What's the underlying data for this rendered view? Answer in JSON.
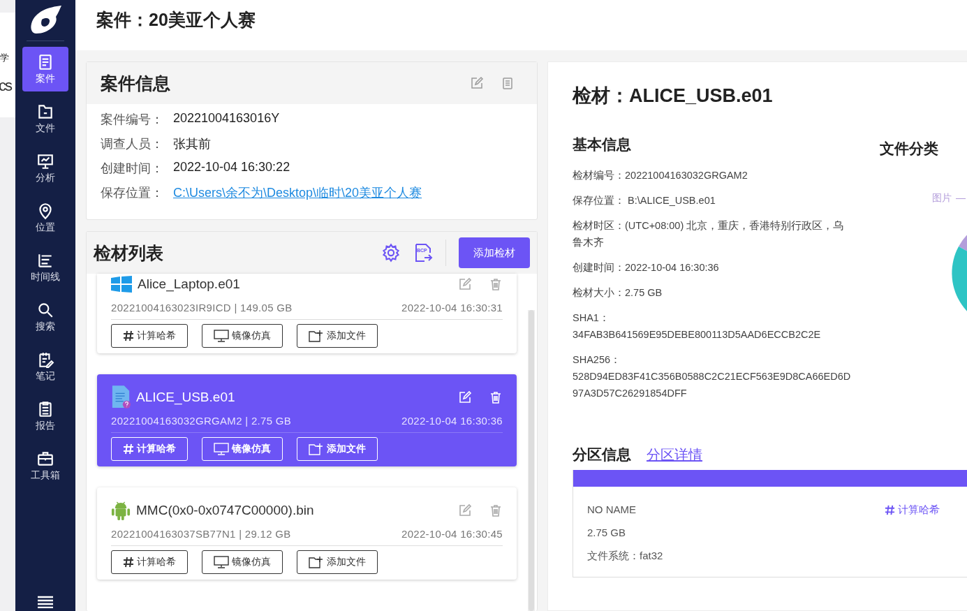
{
  "background_window": {
    "texts": [
      "学",
      "cs"
    ]
  },
  "sidebar": {
    "items": [
      {
        "label": "案件",
        "kind": "case",
        "selected": true
      },
      {
        "label": "文件",
        "kind": "folder",
        "selected": false
      },
      {
        "label": "分析",
        "kind": "analysis",
        "selected": false
      },
      {
        "label": "位置",
        "kind": "location",
        "selected": false
      },
      {
        "label": "时间线",
        "kind": "timeline",
        "selected": false
      },
      {
        "label": "搜索",
        "kind": "search",
        "selected": false
      },
      {
        "label": "笔记",
        "kind": "note",
        "selected": false
      },
      {
        "label": "报告",
        "kind": "report",
        "selected": false
      },
      {
        "label": "工具箱",
        "kind": "toolbox",
        "selected": false
      }
    ]
  },
  "header": {
    "title": "案件：20美亚个人赛"
  },
  "case_info": {
    "title": "案件信息",
    "fields": [
      {
        "label": "案件编号：",
        "value": "20221004163016Y",
        "kind": "text"
      },
      {
        "label": "调查人员：",
        "value": "张其前",
        "kind": "text"
      },
      {
        "label": "创建时间：",
        "value": "2022-10-04 16:30:22",
        "kind": "text"
      },
      {
        "label": "保存位置：",
        "value": "C:\\Users\\余不为\\Desktop\\临时\\20美亚个人赛",
        "kind": "link"
      }
    ]
  },
  "evidence_list": {
    "title": "检材列表",
    "add_button": "添加检材",
    "export_icon_text": "BCP",
    "items": [
      {
        "name": "Alice_Laptop.e01",
        "kind": "windows",
        "meta": "20221004163023IR9ICD | 149.05 GB",
        "time": "2022-10-04 16:30:31",
        "selected": false,
        "actions": [
          "计算哈希",
          "镜像仿真",
          "添加文件"
        ]
      },
      {
        "name": "ALICE_USB.e01",
        "kind": "file",
        "meta": "20221004163032GRGAM2 | 2.75 GB",
        "time": "2022-10-04 16:30:36",
        "selected": true,
        "actions": [
          "计算哈希",
          "镜像仿真",
          "添加文件"
        ]
      },
      {
        "name": "MMC(0x0-0x0747C00000).bin",
        "kind": "android",
        "meta": "20221004163037SB77N1 | 29.12 GB",
        "time": "2022-10-04 16:30:45",
        "selected": false,
        "actions": [
          "计算哈希",
          "镜像仿真",
          "添加文件"
        ]
      }
    ]
  },
  "detail": {
    "title": "检材：ALICE_USB.e01",
    "basic": {
      "title": "基本信息",
      "fields": [
        {
          "label": "检材编号：",
          "value": "20221004163032GRGAM2",
          "kind": "inline"
        },
        {
          "label": "保存位置：",
          "value": " B:\\ALICE_USB.e01",
          "kind": "inline"
        },
        {
          "label": "检材时区：",
          "value": "(UTC+08:00) 北京，重庆，香港特别行政区，乌鲁木齐",
          "kind": "inline"
        },
        {
          "label": "创建时间：",
          "value": "2022-10-04 16:30:36",
          "kind": "inline"
        },
        {
          "label": "检材大小：",
          "value": "2.75 GB",
          "kind": "inline"
        },
        {
          "label": "SHA1：",
          "value": "34FAB3B641569E95DEBE800113D5AAD6ECCB2C2E",
          "kind": "stacked"
        },
        {
          "label": "SHA256：",
          "value": "528D94ED83F41C356B0588C2C21ECF563E9D8CA66ED6D97A3D57C26291854DFF",
          "kind": "stacked"
        }
      ]
    },
    "category": {
      "title": "文件分类",
      "legend": "图片"
    },
    "partition": {
      "title": "分区信息",
      "link": "分区详情",
      "items": [
        {
          "name": "NO NAME",
          "size": "2.75 GB",
          "filesystem": "文件系统：fat32",
          "hash_button": "计算哈希"
        }
      ]
    }
  }
}
